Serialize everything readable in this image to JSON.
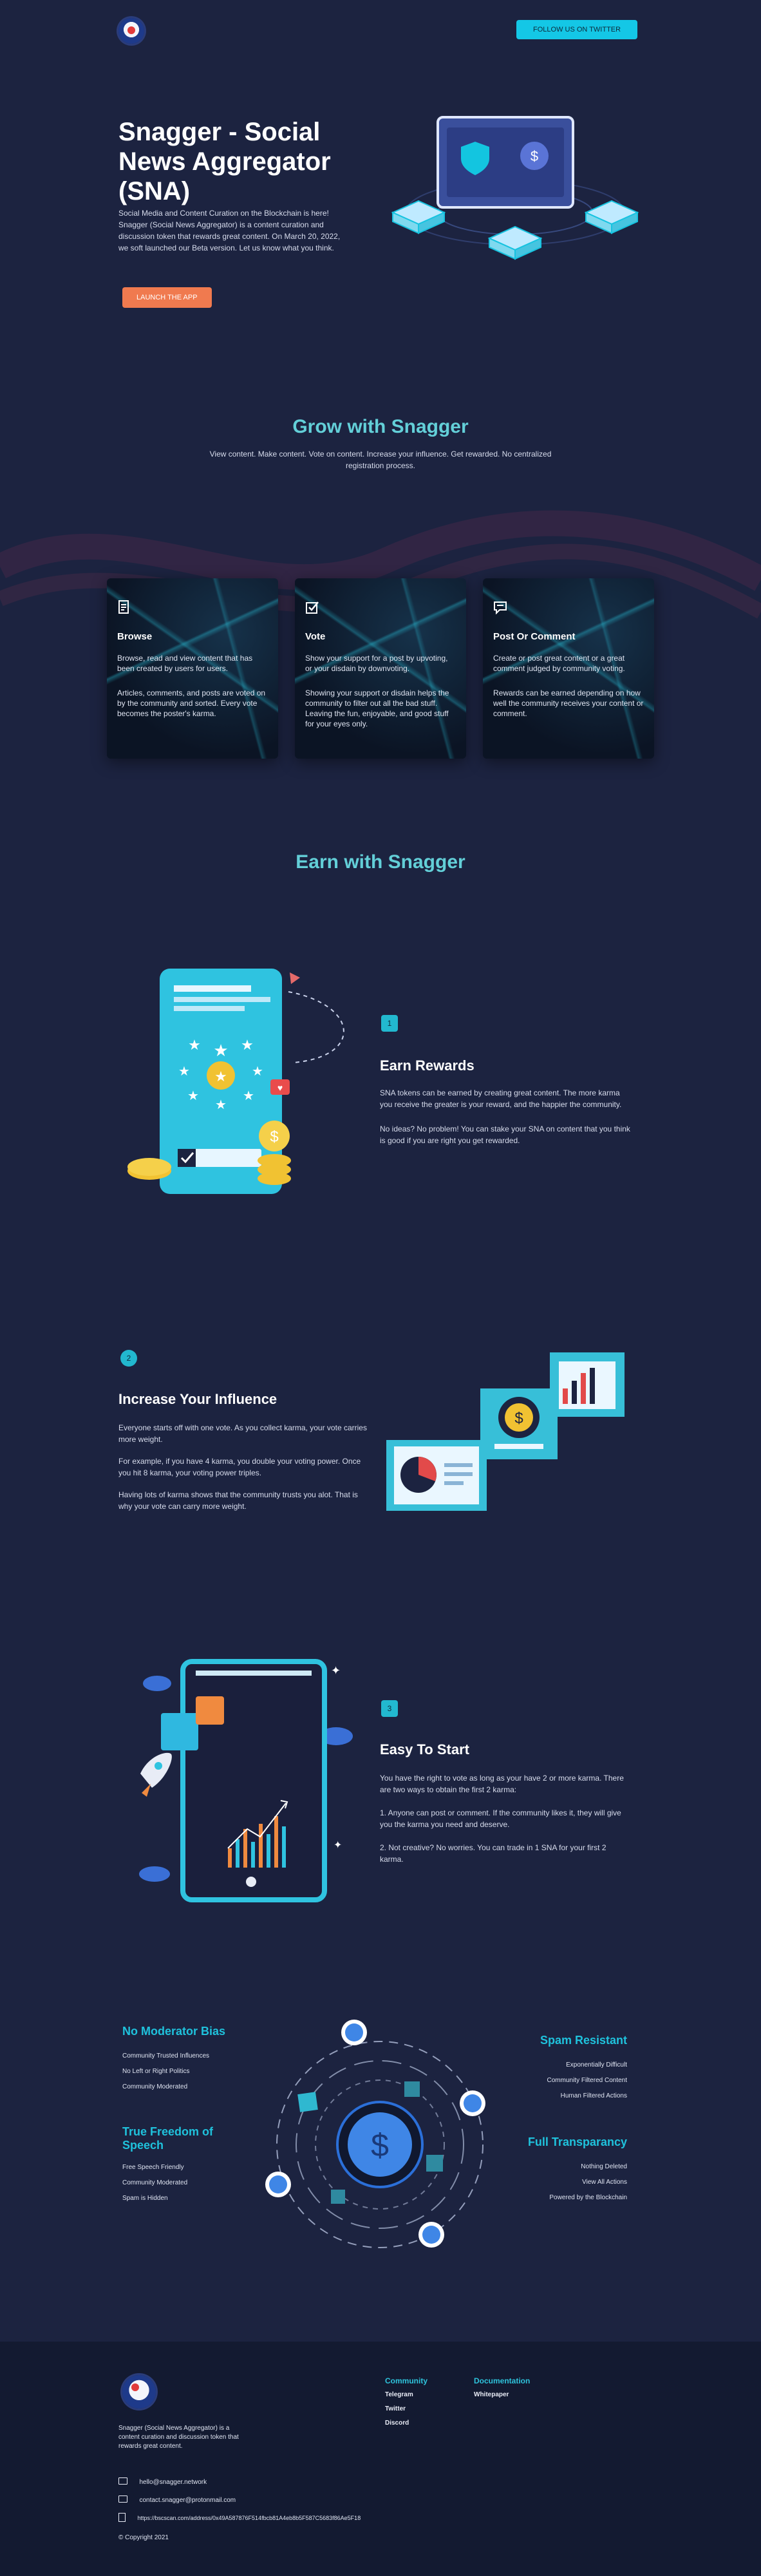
{
  "header": {
    "twitter_button": "FOLLOW US ON TWITTER"
  },
  "hero": {
    "title": "Snagger - Social News Aggregator (SNA)",
    "description": "Social Media and Content Curation on the Blockchain is here! Snagger (Social News Aggregator) is a content curation and discussion token that rewards great content. On March 20, 2022, we soft launched our Beta version. Let us know what you think.",
    "launch_button": "LAUNCH THE APP"
  },
  "grow": {
    "title": "Grow with Snagger",
    "subtitle": "View content. Make content. Vote on content. Increase your influence. Get rewarded. No centralized registration process.",
    "cards": [
      {
        "icon": "document-icon",
        "title": "Browse",
        "p1": "Browse, read and view content that has been created by users for users.",
        "p2": "Articles, comments, and posts are voted on by the community and sorted. Every vote becomes the poster's karma."
      },
      {
        "icon": "checkbox-icon",
        "title": "Vote",
        "p1": "Show your support for a post by upvoting, or your disdain by downvoting.",
        "p2": "Showing your support or disdain helps the community to filter out all the bad stuff. Leaving the fun, enjoyable, and good stuff for your eyes only."
      },
      {
        "icon": "comment-icon",
        "title": "Post Or Comment",
        "p1": "Create or post great content or a great comment judged by community voting.",
        "p2": "Rewards can be earned depending on how well the community receives your content or comment."
      }
    ]
  },
  "earn": {
    "title": "Earn with Snagger",
    "features": [
      {
        "number": "1",
        "title": "Earn Rewards",
        "paragraphs": [
          "SNA tokens can be earned by creating great content. The more karma you receive the greater is your reward, and the happier the community.",
          "No ideas? No problem! You can stake your SNA on content that you think is good if you are right you get rewarded."
        ]
      },
      {
        "number": "2",
        "title": "Increase Your Influence",
        "paragraphs": [
          "Everyone starts off with one vote. As you collect karma, your vote carries more weight.",
          "For example, if you have 4 karma, you double your voting power. Once you hit 8 karma, your voting power triples.",
          "Having lots of karma shows that the community trusts you alot. That is why your vote can carry more weight."
        ]
      },
      {
        "number": "3",
        "title": "Easy To Start",
        "paragraphs": [
          "You have the right to vote as long as your have 2 or more karma. There are two ways to obtain the first 2 karma:",
          "1. Anyone can post or comment. If the community likes it, they will give you the karma you need and deserve.",
          "2. Not creative? No worries. You can trade in 1 SNA for your first 2 karma."
        ]
      }
    ]
  },
  "advantages": {
    "left": [
      {
        "title": "No Moderator Bias",
        "items": [
          "Community Trusted Influences",
          "No Left or Right Politics",
          "Community Moderated"
        ]
      },
      {
        "title": "True Freedom of Speech",
        "items": [
          "Free Speech Friendly",
          "Community Moderated",
          "Spam is Hidden"
        ]
      }
    ],
    "right": [
      {
        "title": "Spam Resistant",
        "items": [
          "Exponentially Difficult",
          "Community Filtered Content",
          "Human Filtered Actions"
        ]
      },
      {
        "title": "Full Transparancy",
        "items": [
          "Nothing Deleted",
          "View All Actions",
          "Powered by the Blockchain"
        ]
      }
    ]
  },
  "footer": {
    "about": "Snagger (Social News Aggregator) is a content curation and discussion token that rewards great content.",
    "community_title": "Community",
    "community_links": [
      "Telegram",
      "Twitter",
      "Discord"
    ],
    "docs_title": "Documentation",
    "docs_links": [
      "Whitepaper"
    ],
    "email": "hello@snagger.network",
    "email2": "contact.snagger@protonmail.com",
    "contract": "https://bscscan.com/address/0x49A587876F514fbcb81A4eb8b5F587C5683f86Ae5F18",
    "copyright": "© Copyright 2021"
  },
  "colors": {
    "background": "#1c2340",
    "accent": "#14c7e6",
    "heading_teal": "#63cfd8",
    "orange": "#f07a4f",
    "footer_bg": "#131a31"
  }
}
